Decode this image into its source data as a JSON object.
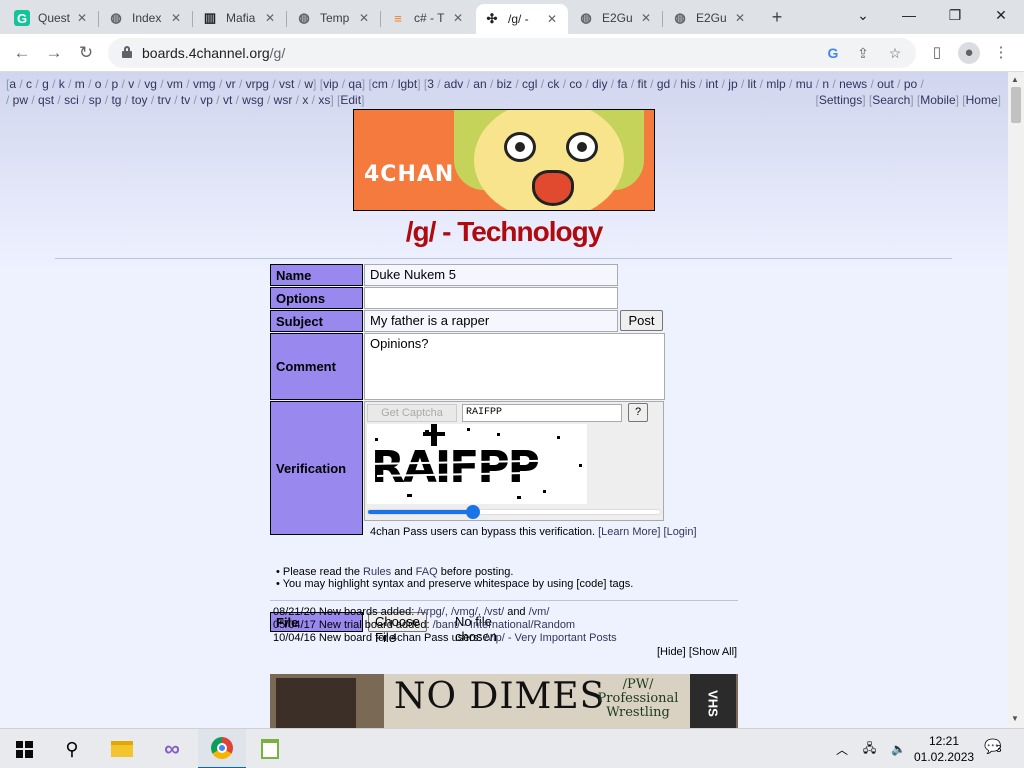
{
  "browser": {
    "tabs": [
      {
        "title": "Quest",
        "icon": "grammarly-icon",
        "color": "#15c39a"
      },
      {
        "title": "Index",
        "icon": "globe-icon",
        "color": "#5f6368"
      },
      {
        "title": "Mafia",
        "icon": "bank-icon",
        "color": "#202124"
      },
      {
        "title": "Temp",
        "icon": "globe-icon",
        "color": "#5f6368"
      },
      {
        "title": "c# - T",
        "icon": "stackoverflow-icon",
        "color": "#f48024"
      },
      {
        "title": "/g/ -",
        "icon": "clover-icon",
        "color": "#202124"
      },
      {
        "title": "E2Gu",
        "icon": "globe-icon",
        "color": "#5f6368"
      },
      {
        "title": "E2Gu",
        "icon": "globe-icon",
        "color": "#5f6368"
      }
    ],
    "active_tab": 5,
    "url_host": "boards.4channel.org",
    "url_path": "/g/"
  },
  "boardlist": {
    "line1": [
      "a",
      "c",
      "g",
      "k",
      "m",
      "o",
      "p",
      "v",
      "vg",
      "vm",
      "vmg",
      "vr",
      "vrpg",
      "vst",
      "w"
    ],
    "group2": [
      "vip",
      "qa"
    ],
    "group3": [
      "cm",
      "lgbt"
    ],
    "group4a": [
      "3",
      "adv",
      "an",
      "biz",
      "cgl",
      "ck",
      "co",
      "diy",
      "fa",
      "fit",
      "gd",
      "his",
      "int",
      "jp",
      "lit",
      "mlp",
      "mu",
      "n",
      "news",
      "out",
      "po"
    ],
    "group4b": [
      "pw",
      "qst",
      "sci",
      "sp",
      "tg",
      "toy",
      "trv",
      "tv",
      "vp",
      "vt",
      "wsg",
      "wsr",
      "x",
      "xs"
    ],
    "edit": "Edit",
    "right_links": [
      "Settings",
      "Search",
      "Mobile",
      "Home"
    ]
  },
  "banner": {
    "logo_text": "4CHAN"
  },
  "board_title": "/g/ - Technology",
  "form": {
    "name_label": "Name",
    "name_value": "Duke Nukem 5",
    "options_label": "Options",
    "options_value": "",
    "subject_label": "Subject",
    "subject_value": "My father is a rapper",
    "post_label": "Post",
    "comment_label": "Comment",
    "comment_value": "Opinions?",
    "verification_label": "Verification",
    "get_captcha_label": "Get Captcha",
    "captcha_value": "RAIFPP",
    "captcha_help": "?",
    "captcha_image_text": "RAIFPP",
    "slider_fraction": 0.36,
    "pass_note_prefix": "4chan Pass users can bypass this verification.",
    "learn_more": "[Learn More]",
    "login": "[Login]",
    "file_label": "File",
    "choose_file": "Choose File",
    "no_file": "No file chosen"
  },
  "rules": {
    "line1_pre": "• Please read the ",
    "rules_link": "Rules",
    "and": " and ",
    "faq_link": "FAQ",
    "line1_post": " before posting.",
    "line2": "• You may highlight syntax and preserve whitespace by using [code] tags."
  },
  "news": [
    {
      "date": "08/21/20",
      "text": "New boards added: ",
      "links": "/vrpg/, /vmg/, /vst/",
      "mid": " and ",
      "link2": "/vm/"
    },
    {
      "date": "05/04/17",
      "text": "New trial board added: ",
      "links": "/bant/ - International/Random",
      "mid": "",
      "link2": ""
    },
    {
      "date": "10/04/16",
      "text": "New board for 4chan Pass users: ",
      "links": "/vip/ - Very Important Posts",
      "mid": "",
      "link2": ""
    }
  ],
  "news_controls": {
    "hide": "[Hide]",
    "show_all": "[Show All]"
  },
  "ad": {
    "main_text": "NO DIMES",
    "side_text": "/PW/ Professional Wrestling",
    "vhs_label": "VHS"
  },
  "taskbar": {
    "time": "12:21",
    "date": "01.02.2023",
    "notifications": "3"
  }
}
